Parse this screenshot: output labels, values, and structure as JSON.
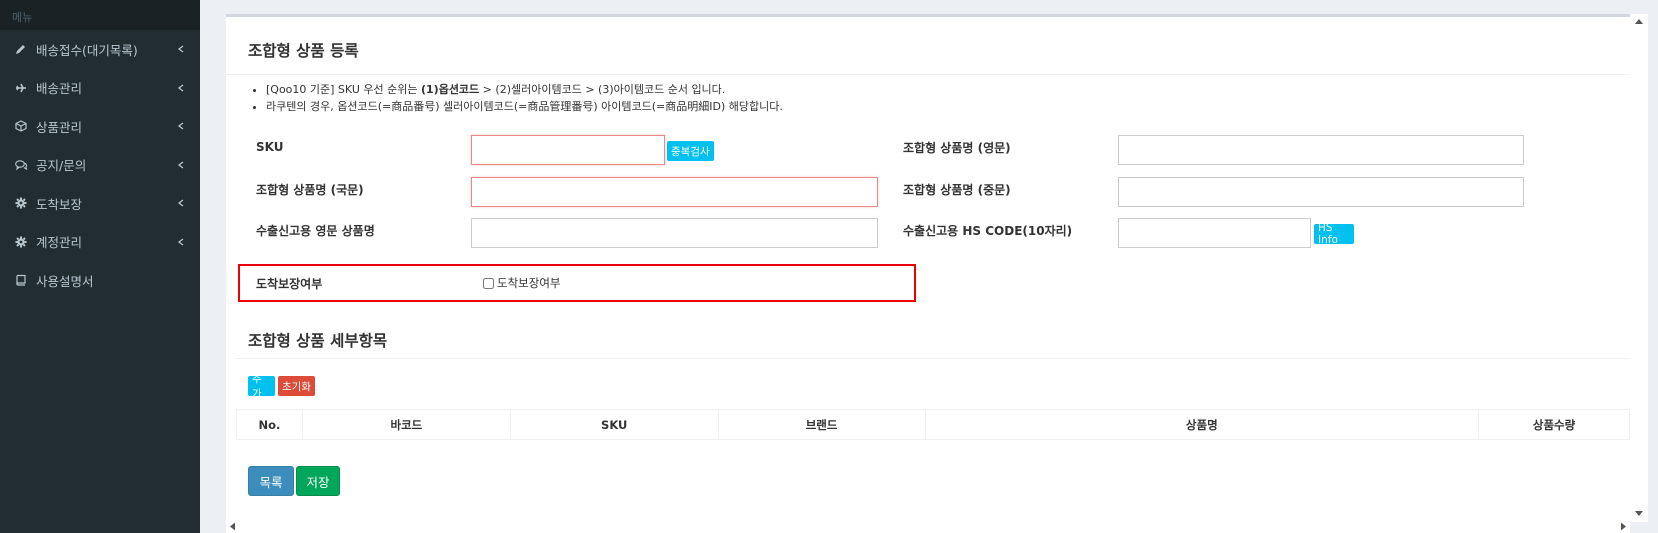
{
  "sidebar": {
    "header": "메뉴",
    "items": [
      {
        "label": "배송접수(대기목록)",
        "icon": "pencil-icon"
      },
      {
        "label": "배송관리",
        "icon": "plane-icon"
      },
      {
        "label": "상품관리",
        "icon": "cube-icon"
      },
      {
        "label": "공지/문의",
        "icon": "comments-icon"
      },
      {
        "label": "도착보장",
        "icon": "gear-icon"
      },
      {
        "label": "계정관리",
        "icon": "gear-icon"
      },
      {
        "label": "사용설명서",
        "icon": "book-icon"
      }
    ]
  },
  "page": {
    "title": "조합형 상품 등록",
    "notes": {
      "n1_prefix": "[Qoo10 기준] SKU 우선 순위는 ",
      "n1_bold": "(1)옵션코드",
      "n1_suffix": " > (2)셀러아이템코드 > (3)아이템코드 순서 입니다.",
      "n2": "라쿠텐의 경우, 옵션코드(=商品番号) 셀러아이템코드(=商品管理番号) 아이템코드(=商品明細ID) 해당합니다."
    }
  },
  "form": {
    "sku_label": "SKU",
    "dup_check": "중복검사",
    "name_en_label": "조합형 상품명 (영문)",
    "name_kr_label": "조합형 상품명 (국문)",
    "name_cn_label": "조합형 상품명 (중문)",
    "export_en_label": "수출신고용 영문 상품명",
    "hs_code_label": "수출신고용 HS CODE(10자리)",
    "hs_info": "HS Info",
    "arrival_label": "도착보장여부",
    "arrival_checkbox": "도착보장여부",
    "arrival_checked": false
  },
  "details": {
    "title": "조합형 상품 세부항목",
    "add": "추가",
    "reset": "초기화",
    "columns": [
      "No.",
      "바코드",
      "SKU",
      "브랜드",
      "상품명",
      "상품수량"
    ]
  },
  "actions": {
    "list": "목록",
    "save": "저장"
  },
  "colors": {
    "sidebar_bg": "#222d32",
    "info": "#00c0ef",
    "danger": "#dd4b39",
    "primary": "#3c8dbc",
    "success": "#00a65a",
    "highlight": "#e00000"
  }
}
